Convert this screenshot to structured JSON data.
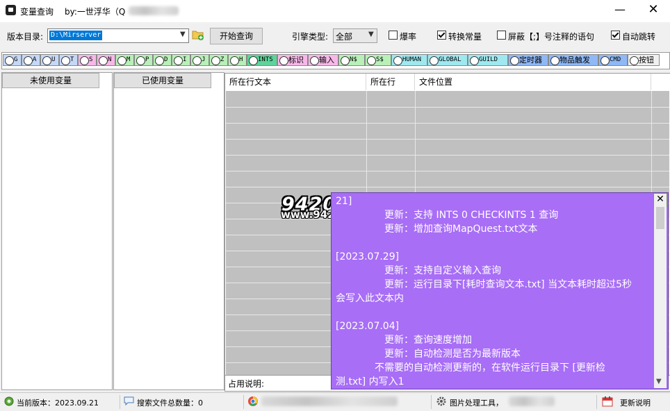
{
  "window": {
    "title": "变量查询",
    "author": "by:一世浮华（Q",
    "minimize_glyph": "—",
    "close_glyph": "✕"
  },
  "toolbar": {
    "dir_label": "版本目录:",
    "dir_value": "D:\\Mirserver",
    "start_button": "开始查询",
    "engine_label": "引擎类型:",
    "engine_value": "全部",
    "checkboxes": [
      {
        "label": "爆率",
        "checked": false
      },
      {
        "label": "转换常量",
        "checked": true
      },
      {
        "label": "屏蔽【;】号注释的语句",
        "checked": false
      },
      {
        "label": "自动跳转",
        "checked": true
      }
    ]
  },
  "radio_options": [
    {
      "label": "G",
      "color": "#c5d8f7"
    },
    {
      "label": "A",
      "color": "#c5d8f7"
    },
    {
      "label": "U",
      "color": "#c5d8f7"
    },
    {
      "label": "T",
      "color": "#c5d8f7"
    },
    {
      "label": "S",
      "color": "#f7b8e8"
    },
    {
      "label": "N",
      "color": "#f7b8e8"
    },
    {
      "label": "M",
      "color": "#b8f0b8"
    },
    {
      "label": "P",
      "color": "#b8f0b8"
    },
    {
      "label": "D",
      "color": "#b8f0b8"
    },
    {
      "label": "I",
      "color": "#b8f0b8"
    },
    {
      "label": "J",
      "color": "#b8f0b8"
    },
    {
      "label": "Z",
      "color": "#b8f0b8"
    },
    {
      "label": "H",
      "color": "#b8f0b8"
    },
    {
      "label": "INTS",
      "color": "#5ed39a"
    },
    {
      "label": "标识",
      "color": "#f7b8e8"
    },
    {
      "label": "输入",
      "color": "#f7b8e8"
    },
    {
      "label": "N$",
      "color": "#b8f0b8"
    },
    {
      "label": "S$",
      "color": "#b8f0b8"
    },
    {
      "label": "HUMAN",
      "color": "#9fe8f0"
    },
    {
      "label": "GLOBAL",
      "color": "#9fe8f0"
    },
    {
      "label": "GUILD",
      "color": "#9fe8f0"
    },
    {
      "label": "定时器",
      "color": "#8fb8f5"
    },
    {
      "label": "物品触发",
      "color": "#8fb8f5"
    },
    {
      "label": "CMD",
      "color": "#8fb8f5"
    },
    {
      "label": "按钮",
      "color": "#f0f0f0"
    }
  ],
  "panels": {
    "unused_title": "未使用变量",
    "used_title": "已使用变量"
  },
  "grid": {
    "columns": [
      "所在行文本",
      "所在行",
      "文件位置"
    ],
    "usage_label": "占用说明:"
  },
  "watermark": {
    "title": "9420Gm论坛",
    "url": "www.9420Gm.com"
  },
  "popup": {
    "lines": [
      "21]",
      "　　　　　更新：支持 INTS 0  CHECKINTS 1  查询",
      "　　　　　更新：增加查询MapQuest.txt文本",
      "",
      "[2023.07.29]",
      "　　　　　更新：支持自定义输入查询",
      "　　　　　更新：运行目录下[耗时查询文本.txt] 当文本耗时超过5秒",
      "会写入此文本内",
      "",
      "[2023.07.04]",
      "　　　　　更新：查询速度增加",
      "　　　　　更新：自动检测是否为最新版本",
      "　　　　不需要的自动检测更新的，在软件运行目录下  [更新检",
      "测.txt]  内写入1"
    ],
    "close_glyph": "✕",
    "accent": "#a86ef6"
  },
  "statusbar": {
    "version_label": "当前版本：2023.09.21",
    "file_count_label": "搜索文件总数量：0",
    "image_tool_label": "图片处理工具，",
    "update_label": "更新说明"
  }
}
